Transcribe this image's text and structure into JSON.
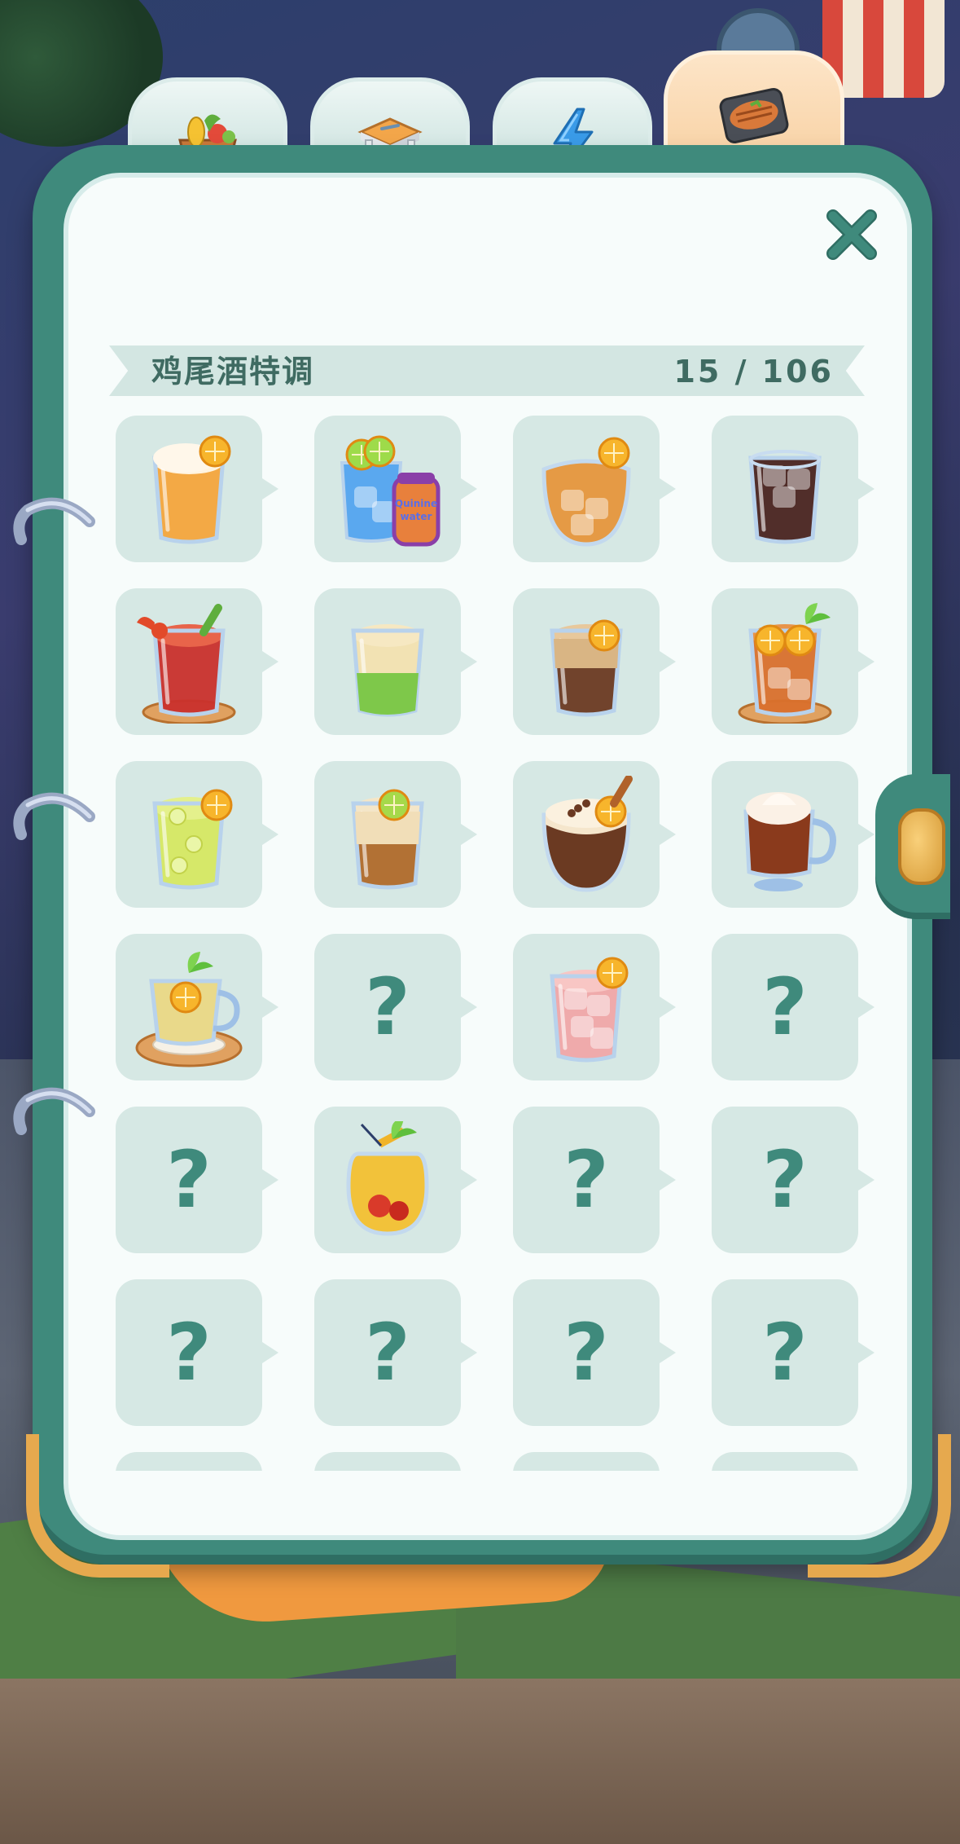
{
  "tabs": [
    {
      "name": "produce-basket-icon",
      "active": false
    },
    {
      "name": "table-icon",
      "active": false
    },
    {
      "name": "lightning-icon",
      "active": false
    },
    {
      "name": "grilled-fish-icon",
      "active": true
    }
  ],
  "header": {
    "title": "鸡尾酒特调",
    "count": "15 / 106"
  },
  "close_icon": "close-icon",
  "colors": {
    "frame": "#3f8a7c",
    "page": "#f7fcfb",
    "cell": "#d6e8e4",
    "text": "#3f6b62",
    "active_tab": "#f7cf9f"
  },
  "grid": {
    "unknown_glyph": "?",
    "items": [
      {
        "icon": "orange-foam-beer-glass",
        "unlocked": true
      },
      {
        "icon": "quinine-water-blue-drink",
        "unlocked": true,
        "can_text": [
          "Quinine",
          "water"
        ]
      },
      {
        "icon": "orange-slice-ice-tumbler",
        "unlocked": true
      },
      {
        "icon": "cola-on-ice-glass",
        "unlocked": true
      },
      {
        "icon": "bloody-mary-crab-glass",
        "unlocked": true
      },
      {
        "icon": "green-layered-cream-glass",
        "unlocked": true
      },
      {
        "icon": "coffee-lemon-layered-glass",
        "unlocked": true
      },
      {
        "icon": "iced-tea-orange-mint",
        "unlocked": true
      },
      {
        "icon": "lemon-soda-glass",
        "unlocked": true
      },
      {
        "icon": "lime-layered-shot-glass",
        "unlocked": true
      },
      {
        "icon": "coffee-cinnamon-orange-glass",
        "unlocked": true
      },
      {
        "icon": "cream-topped-mug",
        "unlocked": true
      },
      {
        "icon": "lemon-tea-cup-coaster",
        "unlocked": true
      },
      {
        "icon": "unknown",
        "unlocked": false
      },
      {
        "icon": "pink-ice-lemon-glass",
        "unlocked": true
      },
      {
        "icon": "unknown",
        "unlocked": false
      },
      {
        "icon": "unknown",
        "unlocked": false
      },
      {
        "icon": "pineapple-cherry-jar",
        "unlocked": true
      },
      {
        "icon": "unknown",
        "unlocked": false
      },
      {
        "icon": "unknown",
        "unlocked": false
      },
      {
        "icon": "unknown",
        "unlocked": false
      },
      {
        "icon": "unknown",
        "unlocked": false
      },
      {
        "icon": "unknown",
        "unlocked": false
      },
      {
        "icon": "unknown",
        "unlocked": false
      }
    ]
  }
}
